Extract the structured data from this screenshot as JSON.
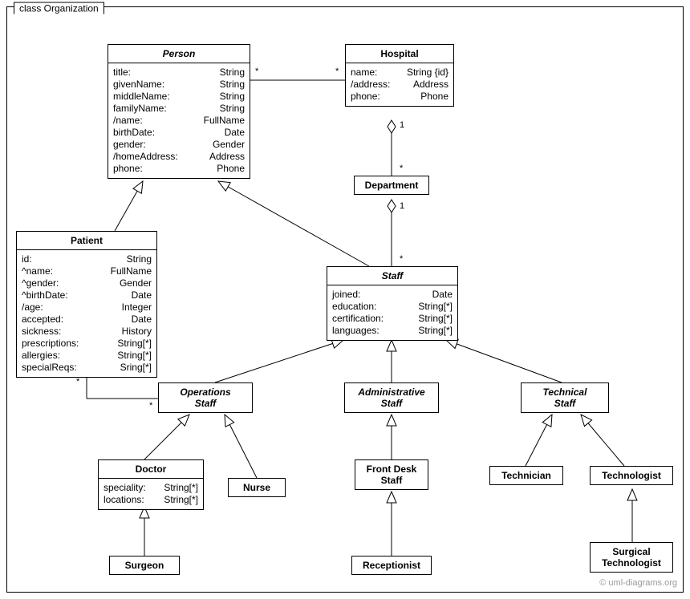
{
  "frame_label": "class Organization",
  "watermark": "© uml-diagrams.org",
  "classes": {
    "Person": {
      "title": "Person",
      "attrs": [
        {
          "k": "title:",
          "v": "String"
        },
        {
          "k": "givenName:",
          "v": "String"
        },
        {
          "k": "middleName:",
          "v": "String"
        },
        {
          "k": "familyName:",
          "v": "String"
        },
        {
          "k": "/name:",
          "v": "FullName"
        },
        {
          "k": "birthDate:",
          "v": "Date"
        },
        {
          "k": "gender:",
          "v": "Gender"
        },
        {
          "k": "/homeAddress:",
          "v": "Address"
        },
        {
          "k": "phone:",
          "v": "Phone"
        }
      ]
    },
    "Hospital": {
      "title": "Hospital",
      "attrs": [
        {
          "k": "name:",
          "v": "String {id}"
        },
        {
          "k": "/address:",
          "v": "Address"
        },
        {
          "k": "phone:",
          "v": "Phone"
        }
      ]
    },
    "Department": {
      "title": "Department",
      "attrs": []
    },
    "Patient": {
      "title": "Patient",
      "attrs": [
        {
          "k": "id:",
          "v": "String"
        },
        {
          "k": "^name:",
          "v": "FullName"
        },
        {
          "k": "^gender:",
          "v": "Gender"
        },
        {
          "k": "^birthDate:",
          "v": "Date"
        },
        {
          "k": "/age:",
          "v": "Integer"
        },
        {
          "k": "accepted:",
          "v": "Date"
        },
        {
          "k": "sickness:",
          "v": "History"
        },
        {
          "k": "prescriptions:",
          "v": "String[*]"
        },
        {
          "k": "allergies:",
          "v": "String[*]"
        },
        {
          "k": "specialReqs:",
          "v": "Sring[*]"
        }
      ]
    },
    "Staff": {
      "title": "Staff",
      "attrs": [
        {
          "k": "joined:",
          "v": "Date"
        },
        {
          "k": "education:",
          "v": "String[*]"
        },
        {
          "k": "certification:",
          "v": "String[*]"
        },
        {
          "k": "languages:",
          "v": "String[*]"
        }
      ]
    },
    "OperationsStaff": {
      "title": "Operations\nStaff",
      "attrs": []
    },
    "AdministrativeStaff": {
      "title": "Administrative\nStaff",
      "attrs": []
    },
    "TechnicalStaff": {
      "title": "Technical\nStaff",
      "attrs": []
    },
    "Doctor": {
      "title": "Doctor",
      "attrs": [
        {
          "k": "speciality:",
          "v": "String[*]"
        },
        {
          "k": "locations:",
          "v": "String[*]"
        }
      ]
    },
    "Nurse": {
      "title": "Nurse",
      "attrs": []
    },
    "FrontDeskStaff": {
      "title": "Front Desk\nStaff",
      "attrs": []
    },
    "Technician": {
      "title": "Technician",
      "attrs": []
    },
    "Technologist": {
      "title": "Technologist",
      "attrs": []
    },
    "Surgeon": {
      "title": "Surgeon",
      "attrs": []
    },
    "Receptionist": {
      "title": "Receptionist",
      "attrs": []
    },
    "SurgicalTechnologist": {
      "title": "Surgical\nTechnologist",
      "attrs": []
    }
  },
  "multiplicities": {
    "person_hospital_left": "*",
    "person_hospital_right": "*",
    "hospital_dept_top": "1",
    "hospital_dept_bottom": "*",
    "dept_staff_top": "1",
    "dept_staff_bottom": "*",
    "patient_ops_top": "*",
    "patient_ops_bottom": "*"
  }
}
